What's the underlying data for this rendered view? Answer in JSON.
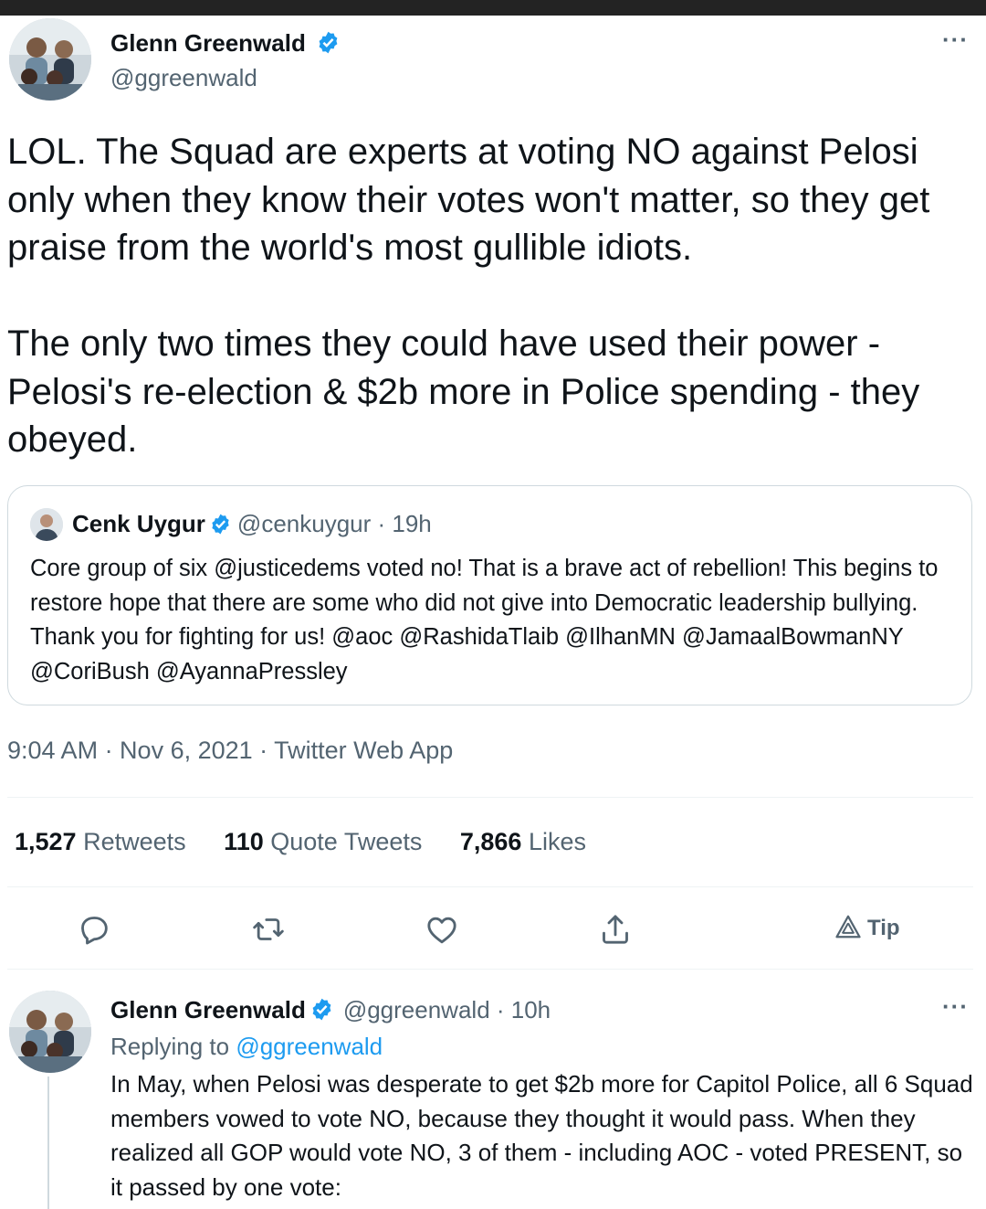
{
  "main_tweet": {
    "author_name": "Glenn Greenwald",
    "author_handle": "@ggreenwald",
    "text": "LOL. The Squad are experts at voting NO against Pelosi only when they know their votes won't matter, so they get praise from the world's most gullible idiots.\n\nThe only two times they could have used their power - Pelosi's re-election & $2b more in Police spending - they obeyed.",
    "more_label": "···",
    "quoted": {
      "author_name": "Cenk Uygur",
      "meta": "@cenkuygur · 19h",
      "text": "Core group of six @justicedems voted no! That is a brave act of rebellion! This begins to restore hope that there are some who did not give into Democratic leadership bullying. Thank you for fighting for us! @aoc @RashidaTlaib @IlhanMN @JamaalBowmanNY @CoriBush @AyannaPressley"
    },
    "timestamp": "9:04 AM · Nov 6, 2021 · Twitter Web App",
    "stats": {
      "retweets_count": "1,527",
      "retweets_label": "Retweets",
      "quotes_count": "110",
      "quotes_label": "Quote Tweets",
      "likes_count": "7,866",
      "likes_label": "Likes"
    },
    "actions": {
      "icons": [
        "reply-icon",
        "retweet-icon",
        "like-icon",
        "share-icon",
        "tip-icon"
      ],
      "tip_label": "Tip"
    }
  },
  "reply_tweet": {
    "author_name": "Glenn Greenwald",
    "meta": "@ggreenwald · 10h",
    "replying_prefix": "Replying to",
    "replying_handle": "@ggreenwald",
    "text": "In May, when Pelosi was desperate to get $2b more for Capitol Police, all 6 Squad members vowed to vote NO, because they thought it would pass. When they realized all GOP would vote NO, 3 of them - including AOC - voted PRESENT, so it passed by one vote:",
    "more_label": "···"
  },
  "colors": {
    "text_primary": "#0f1419",
    "text_secondary": "#536471",
    "accent": "#1d9bf0",
    "border": "#cfd9de",
    "verified": "#1d9bf0"
  }
}
